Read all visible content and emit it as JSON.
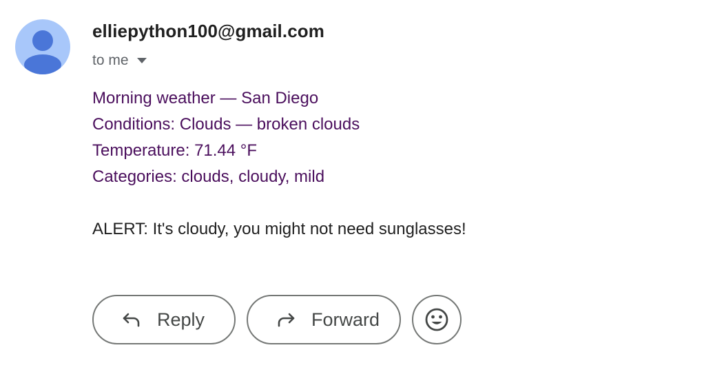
{
  "message": {
    "sender": "elliepython100@gmail.com",
    "recipient_label": "to me",
    "body_lines": [
      "Morning weather — San Diego",
      "Conditions: Clouds — broken clouds",
      "Temperature: 71.44 °F",
      "Categories: clouds, cloudy, mild"
    ],
    "alert": "ALERT: It's cloudy, you might not need sunglasses!"
  },
  "actions": {
    "reply_label": "Reply",
    "forward_label": "Forward"
  },
  "icons": {
    "avatar": "person-icon",
    "recipient_toggle": "caret-down-icon",
    "reply": "reply-arrow-icon",
    "forward": "forward-arrow-icon",
    "emoji": "smiley-icon"
  },
  "colors": {
    "avatar_background": "#a8c7fa",
    "avatar_figure": "#4a76d8",
    "body_text": "#4a0e5c",
    "button_border": "#747775"
  }
}
